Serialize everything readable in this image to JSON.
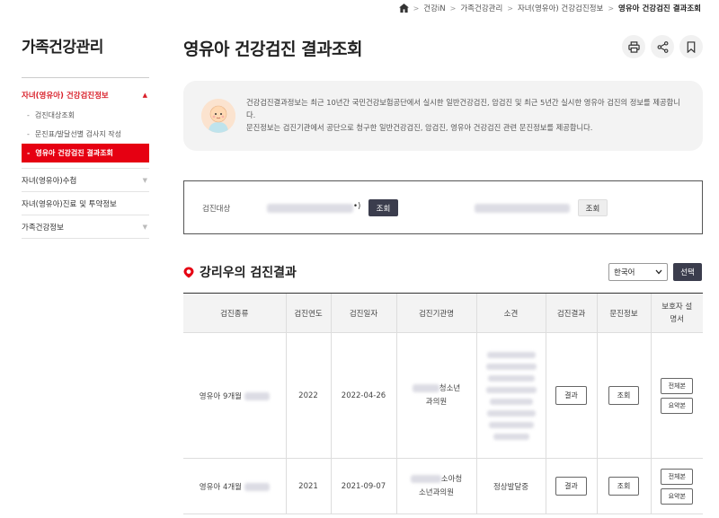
{
  "breadcrumb": {
    "items": [
      "건강iN",
      "가족건강관리",
      "자녀(영유아) 건강검진정보"
    ],
    "current": "영유아 건강검진 결과조회"
  },
  "sidebar": {
    "title": "가족건강관리",
    "active_item": "자녀(영유아) 건강검진정보",
    "sub_items": [
      "검진대상조회",
      "문진표/발달선별 검사지 작성",
      "영유아 건강검진 결과조회"
    ],
    "items": [
      "자녀(영유아)수첩",
      "자녀(영유아)진료 및 투약정보",
      "가족건강정보"
    ]
  },
  "page": {
    "title": "영유아 건강검진 결과조회"
  },
  "info": {
    "line1": "건강검진결과정보는 최근 10년간 국민건강보험공단에서 실시한 일반건강검진, 암검진 및 최근 5년간 실시한 영유아 검진의 정보를 제공합니다.",
    "line2": "문진정보는 검진기관에서 공단으로 청구한 일반건강검진, 암검진, 영유아 건강검진 관련 문진정보를 제공합니다."
  },
  "search": {
    "label": "검진대상",
    "button1": "조회",
    "button2": "조회",
    "suffix": "•)"
  },
  "results": {
    "title": "강리우의 검진결과",
    "lang": "한국어",
    "select_button": "선택",
    "columns": [
      "검진종류",
      "검진연도",
      "검진일자",
      "검진기관명",
      "소견",
      "검진결과",
      "문진정보",
      "보호자 설명서"
    ],
    "rows": [
      {
        "type": "영유아 9개월",
        "year": "2022",
        "date": "2022-04-26",
        "org1": "청소년",
        "org2": "과의원",
        "opinion": "",
        "result_btn": "결과",
        "inquiry_btn": "조회",
        "full_btn": "전체본",
        "summary_btn": "요약본"
      },
      {
        "type": "영유아 4개월",
        "year": "2021",
        "date": "2021-09-07",
        "org1": "소아청",
        "org2": "소년과의원",
        "opinion": "정상발달중",
        "result_btn": "결과",
        "inquiry_btn": "조회",
        "full_btn": "전체본",
        "summary_btn": "요약본"
      }
    ]
  }
}
